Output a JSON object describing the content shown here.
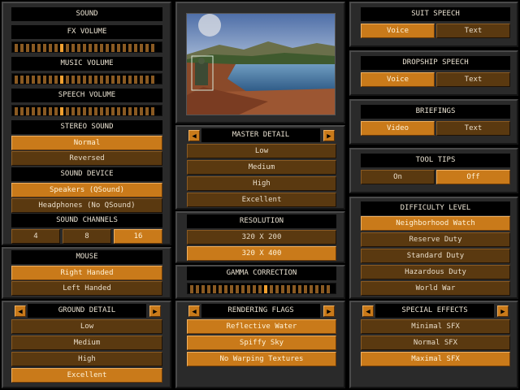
{
  "sound": {
    "title": "SOUND",
    "fx_volume": "FX VOLUME",
    "music_volume": "MUSIC VOLUME",
    "speech_volume": "SPEECH VOLUME",
    "fx_level": 0.35,
    "music_level": 0.35,
    "speech_level": 0.35,
    "stereo_title": "STEREO SOUND",
    "stereo_options": [
      "Normal",
      "Reversed"
    ],
    "stereo_selected": 0,
    "device_title": "SOUND DEVICE",
    "device_options": [
      "Speakers (QSound)",
      "Headphones (No QSound)"
    ],
    "device_selected": 0,
    "channels_title": "SOUND CHANNELS",
    "channel_options": [
      "4",
      "8",
      "16"
    ],
    "channel_selected": 2
  },
  "mouse": {
    "title": "MOUSE",
    "options": [
      "Right Handed",
      "Left Handed"
    ],
    "selected": 0
  },
  "ground_detail": {
    "title": "GROUND DETAIL",
    "options": [
      "Low",
      "Medium",
      "High",
      "Excellent"
    ],
    "selected": 3
  },
  "master_detail": {
    "title": "MASTER DETAIL",
    "options": [
      "Low",
      "Medium",
      "High",
      "Excellent"
    ],
    "selected": -1
  },
  "resolution": {
    "title": "RESOLUTION",
    "options": [
      "320 X 200",
      "320 X 400"
    ],
    "selected": 1
  },
  "gamma": {
    "title": "GAMMA CORRECTION",
    "level": 0.55
  },
  "rendering_flags": {
    "title": "RENDERING FLAGS",
    "options": [
      "Reflective Water",
      "Spiffy Sky",
      "No Warping Textures"
    ],
    "selected": [
      0,
      1,
      2
    ]
  },
  "suit_speech": {
    "title": "SUIT SPEECH",
    "options": [
      "Voice",
      "Text"
    ],
    "selected": 0
  },
  "dropship_speech": {
    "title": "DROPSHIP SPEECH",
    "options": [
      "Voice",
      "Text"
    ],
    "selected": 0
  },
  "briefings": {
    "title": "BRIEFINGS",
    "options": [
      "Video",
      "Text"
    ],
    "selected": 0
  },
  "tool_tips": {
    "title": "TOOL TIPS",
    "options": [
      "On",
      "Off"
    ],
    "selected": 1
  },
  "difficulty": {
    "title": "DIFFICULTY LEVEL",
    "options": [
      "Neighborhood Watch",
      "Reserve Duty",
      "Standard Duty",
      "Hazardous Duty",
      "World War"
    ],
    "selected": 0
  },
  "special_effects": {
    "title": "SPECIAL EFFECTS",
    "options": [
      "Minimal SFX",
      "Normal SFX",
      "Maximal SFX"
    ],
    "selected": 2
  },
  "icons": {
    "left_arrow": "◀",
    "right_arrow": "▶"
  },
  "colors": {
    "selected": "#c97a1a",
    "unselected": "#5a3910",
    "header": "#000000",
    "panel": "#2a2a2a"
  }
}
